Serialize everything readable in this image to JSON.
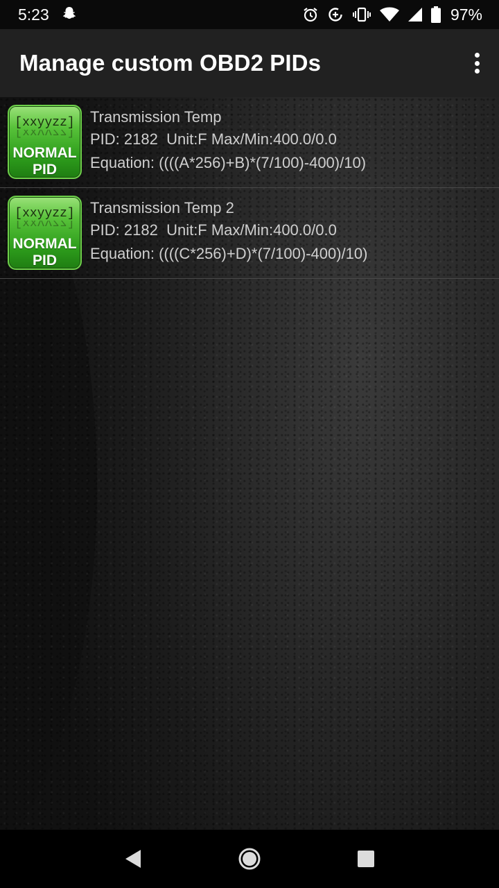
{
  "status_bar": {
    "time": "5:23",
    "battery": "97%",
    "icons": [
      "snapchat-ghost-icon",
      "alarm-icon",
      "data-saver-icon",
      "vibrate-icon",
      "wifi-icon",
      "signal-icon",
      "battery-icon"
    ]
  },
  "app_bar": {
    "title": "Manage custom OBD2 PIDs",
    "overflow_icon": "more-vert-icon"
  },
  "pids": [
    {
      "icon_code": "[xxyyzz]",
      "icon_label_1": "NORMAL",
      "icon_label_2": "PID",
      "name": "Transmission Temp",
      "details": "PID: 2182  Unit:F Max/Min:400.0/0.0",
      "equation": "Equation: ((((A*256)+B)*(7/100)-400)/10)"
    },
    {
      "icon_code": "[xxyyzz]",
      "icon_label_1": "NORMAL",
      "icon_label_2": "PID",
      "name": "Transmission Temp 2",
      "details": "PID: 2182  Unit:F Max/Min:400.0/0.0",
      "equation": "Equation: ((((C*256)+D)*(7/100)-400)/10)"
    }
  ],
  "nav_bar": {
    "back_icon": "back-triangle-icon",
    "home_icon": "home-circle-icon",
    "recents_icon": "recents-square-icon"
  },
  "colors": {
    "app_bar": "#212121",
    "icon_green": "#2e9e1c",
    "text": "#cfcfcf"
  }
}
